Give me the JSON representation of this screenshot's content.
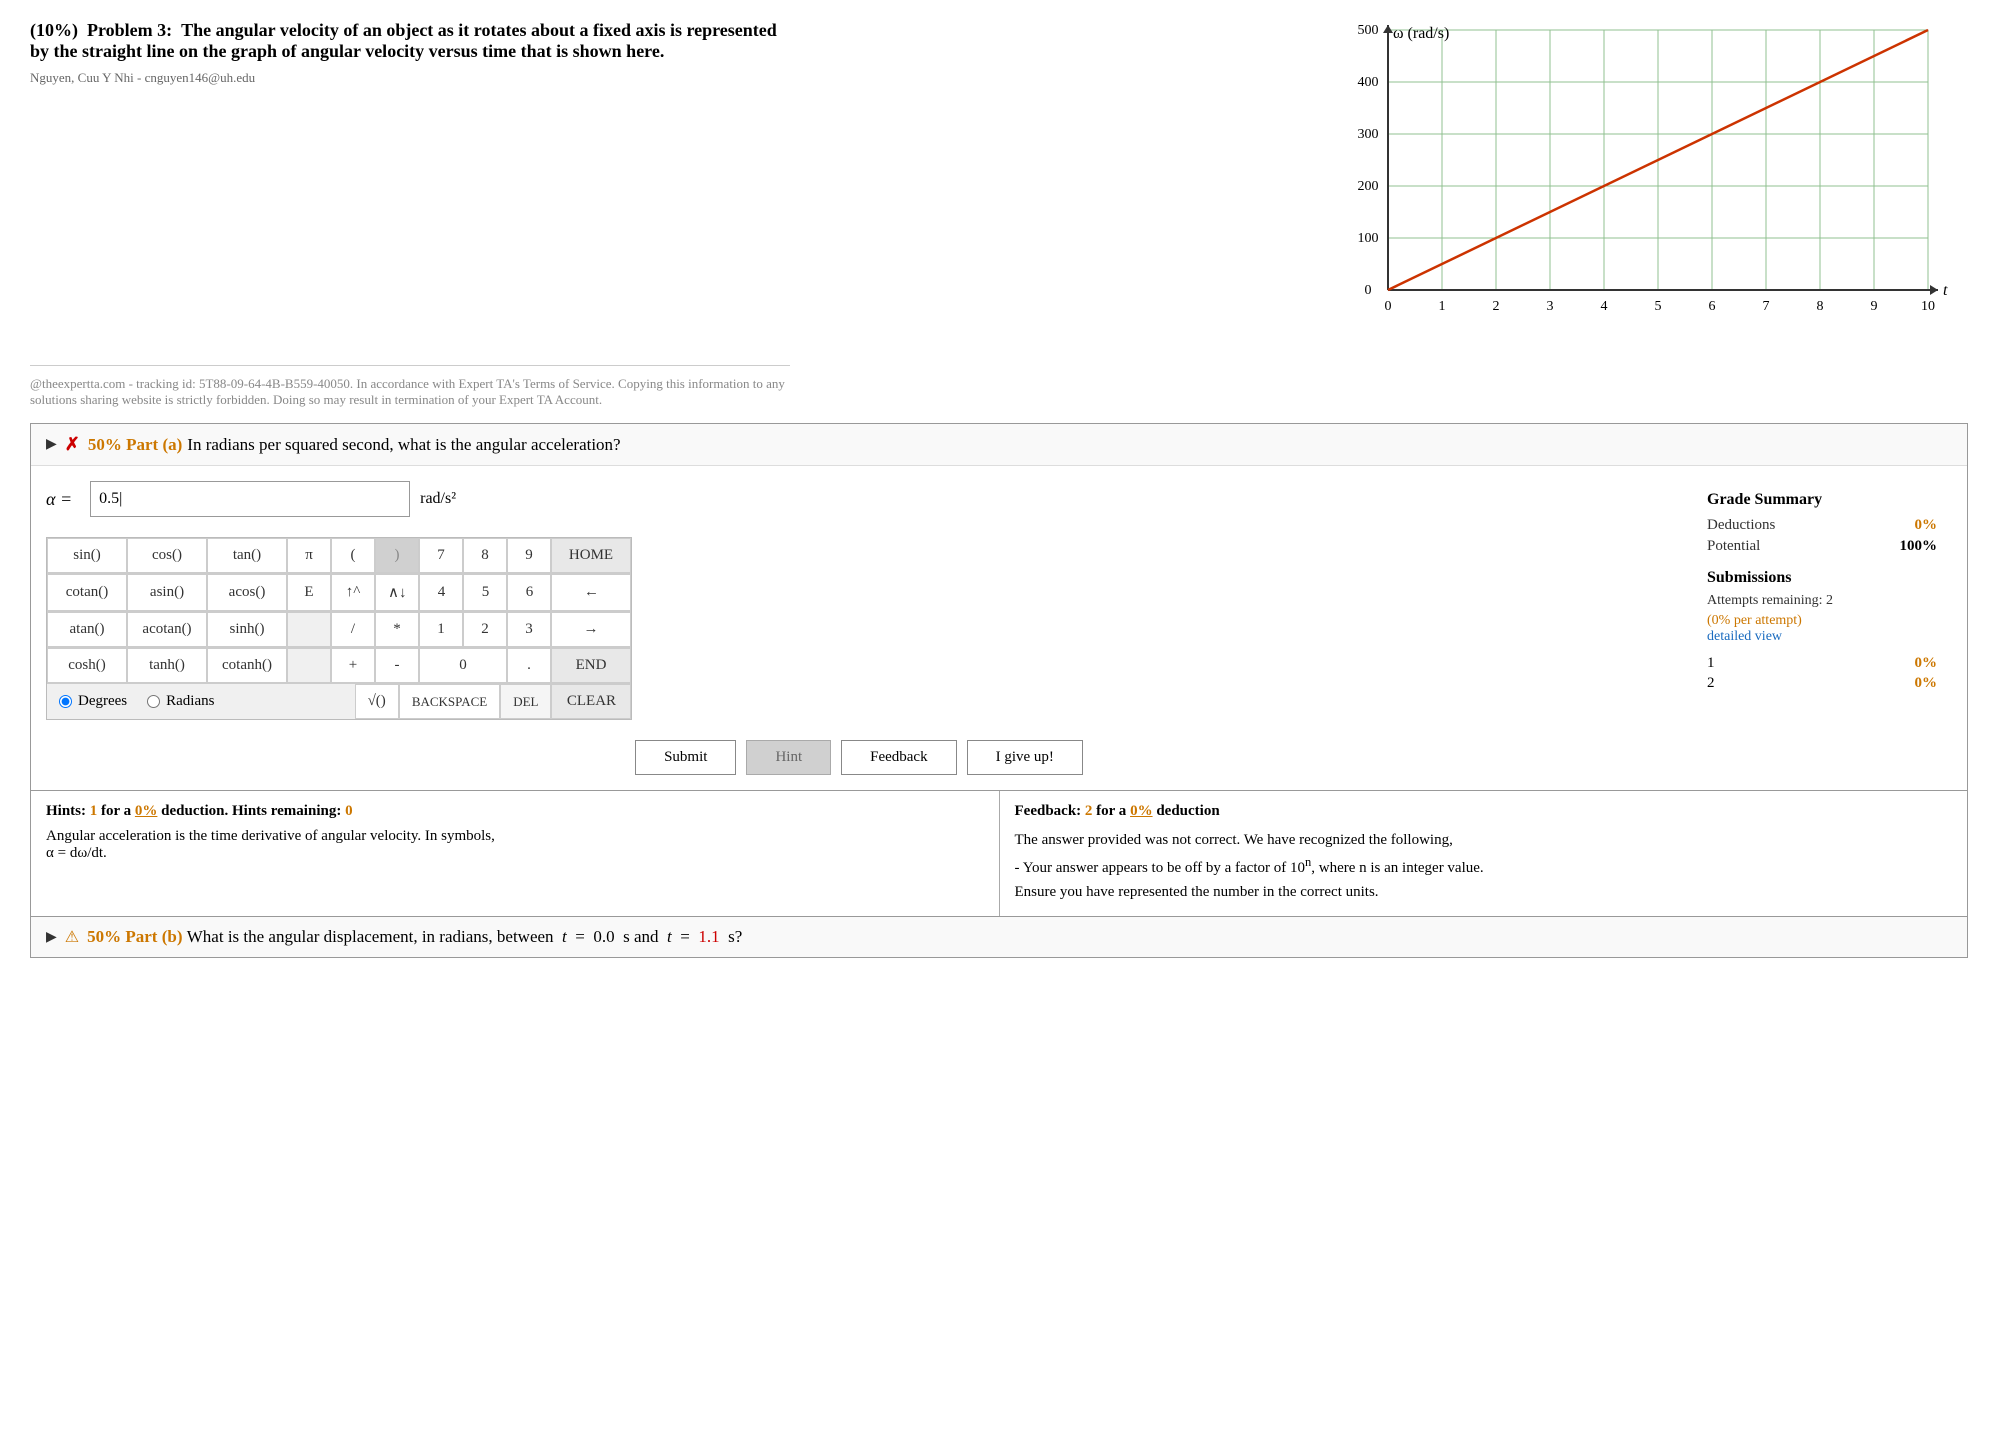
{
  "problem": {
    "number": "Problem 3:",
    "weight": "(10%)",
    "description": "The angular velocity of an object as it rotates about a fixed axis is represented by the straight line on the graph of angular velocity versus time that is shown here.",
    "student": "Nguyen, Cuu Y Nhi - cnguyen146@uh.edu"
  },
  "graph": {
    "x_label": "t",
    "y_label": "ω (rad/s)",
    "x_max": "10",
    "y_max": "500",
    "x_ticks": [
      "0",
      "1",
      "2",
      "3",
      "4",
      "5",
      "6",
      "7",
      "8",
      "9",
      "10"
    ],
    "y_ticks": [
      "0",
      "100",
      "200",
      "300",
      "400",
      "500"
    ]
  },
  "tracking": {
    "text": "@theexpertta.com - tracking id: 5T88-09-64-4B-B559-40050. In accordance with Expert TA's Terms of Service. Copying this information to any solutions sharing website is strictly forbidden. Doing so may result in termination of your Expert TA Account."
  },
  "part_a": {
    "label": "50% Part (a)",
    "question": "In radians per squared second, what is the angular acceleration?",
    "answer_label": "α =",
    "answer_value": "0.5|",
    "answer_unit": "rad/s²",
    "status_icon": "✗",
    "arrow": "▶"
  },
  "calculator": {
    "buttons": {
      "row1": [
        "sin()",
        "cos()",
        "tan()",
        "π",
        "(",
        ")",
        "7",
        "8",
        "9",
        "HOME"
      ],
      "row2": [
        "cotan()",
        "asin()",
        "acos()",
        "E",
        "↑^",
        "∧↓",
        "4",
        "5",
        "6",
        "←"
      ],
      "row3": [
        "atan()",
        "acotan()",
        "sinh()",
        "",
        "/",
        "*",
        "1",
        "2",
        "3",
        "→"
      ],
      "row4": [
        "cosh()",
        "tanh()",
        "cotanh()",
        "",
        "+",
        "-",
        "0",
        ".",
        "END"
      ],
      "row5_radio": [
        "Degrees",
        "Radians"
      ],
      "row5_btns": [
        "√()",
        "BACKSPACE",
        "DEL",
        "CLEAR"
      ]
    }
  },
  "action_buttons": {
    "submit": "Submit",
    "hint": "Hint",
    "feedback": "Feedback",
    "igiveup": "I give up!"
  },
  "grade_summary": {
    "title": "Grade Summary",
    "deductions_label": "Deductions",
    "deductions_value": "0%",
    "potential_label": "Potential",
    "potential_value": "100%",
    "submissions_title": "Submissions",
    "attempts_label": "Attempts remaining:",
    "attempts_value": "2",
    "per_attempt": "(0% per attempt)",
    "detailed_view": "detailed view",
    "rows": [
      {
        "num": "1",
        "score": "0%"
      },
      {
        "num": "2",
        "score": "0%"
      }
    ]
  },
  "hints_section": {
    "label": "Hints:",
    "hint_number": "1",
    "hint_pct": "0%",
    "hint_deduction_text": "for a",
    "hint_deduction_label": "deduction. Hints remaining:",
    "hints_remaining": "0",
    "content_line1": "Angular acceleration is the time derivative of angular velocity. In symbols,",
    "content_line2": "α = dω/dt."
  },
  "feedback_section": {
    "label": "Feedback:",
    "feedback_number": "2",
    "feedback_pct": "0%",
    "feedback_deduction_text": "for a",
    "feedback_deduction_label": "deduction",
    "content_line1": "The answer provided was not correct. We have recognized the following,",
    "content_line2": "- Your answer appears to be off by a factor of 10ⁿ, where n is an integer value.",
    "content_line3": "Ensure you have represented the number in the correct units."
  },
  "part_b": {
    "label": "50% Part (b)",
    "question_prefix": "What is the angular displacement, in radians, between",
    "t1_label": "t",
    "t1_value": "0.0",
    "t1_unit": "s and",
    "t2_label": "t",
    "t2_value": "1.1",
    "t2_unit": "s?",
    "arrow": "▶",
    "warning_icon": "⚠"
  }
}
